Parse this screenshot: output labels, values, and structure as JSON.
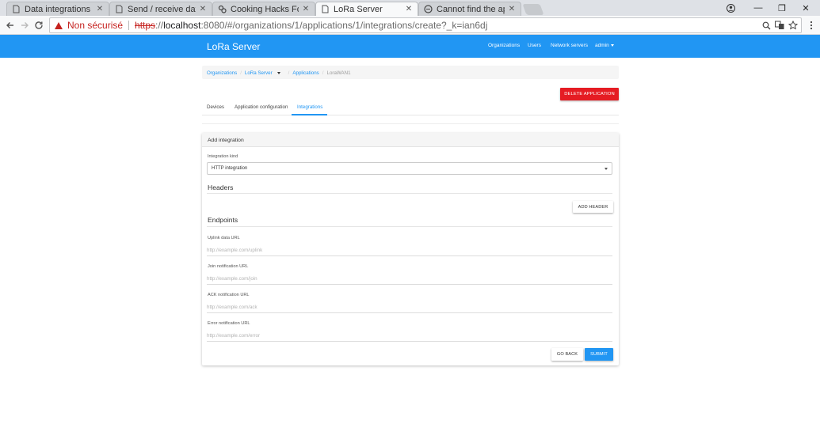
{
  "browser": {
    "tabs": [
      {
        "title": "Data integrations - LoRa",
        "icon": "page-icon",
        "active": false
      },
      {
        "title": "Send / receive data - LoR",
        "icon": "page-icon",
        "active": false
      },
      {
        "title": "Cooking Hacks Forum • ",
        "icon": "cooking-hacks-icon",
        "active": false
      },
      {
        "title": "LoRa Server",
        "icon": "page-icon",
        "active": true
      },
      {
        "title": "Cannot find the applicatio",
        "icon": "github-icon",
        "active": false
      }
    ],
    "close_glyph": "✕",
    "security_label": "Non sécurisé",
    "url": {
      "scheme": "https",
      "rest_prefix": "://",
      "host": "localhost",
      "path": ":8080/#/organizations/1/applications/1/integrations/create?_k=ian6dj"
    },
    "window_controls": {
      "minimize": "—",
      "restore": "❐",
      "close": "✕"
    }
  },
  "appbar": {
    "brand": "LoRa Server",
    "nav": {
      "organizations": "Organizations",
      "users": "Users",
      "network_servers": "Network servers",
      "admin": "admin"
    }
  },
  "breadcrumb": {
    "organizations": "Organizations",
    "org_name": "LoRa Server",
    "applications": "Applications",
    "current": "LoraWAN1",
    "separator": "/"
  },
  "actions": {
    "delete_application": "DELETE APPLICATION"
  },
  "tabs": {
    "devices": "Devices",
    "application_configuration": "Application configuration",
    "integrations": "Integrations"
  },
  "card": {
    "title": "Add integration",
    "integration_kind_label": "Integration kind",
    "integration_kind_value": "HTTP integration",
    "headers_title": "Headers",
    "add_header": "ADD HEADER",
    "endpoints_title": "Endpoints",
    "fields": {
      "uplink": {
        "label": "Uplink data URL",
        "placeholder": "http://example.com/uplink",
        "value": ""
      },
      "join": {
        "label": "Join notification URL",
        "placeholder": "http://example.com/join",
        "value": ""
      },
      "ack": {
        "label": "ACK notification URL",
        "placeholder": "http://example.com/ack",
        "value": ""
      },
      "error": {
        "label": "Error notification URL",
        "placeholder": "http://example.com/error",
        "value": ""
      }
    },
    "go_back": "GO BACK",
    "submit": "SUBMIT"
  }
}
